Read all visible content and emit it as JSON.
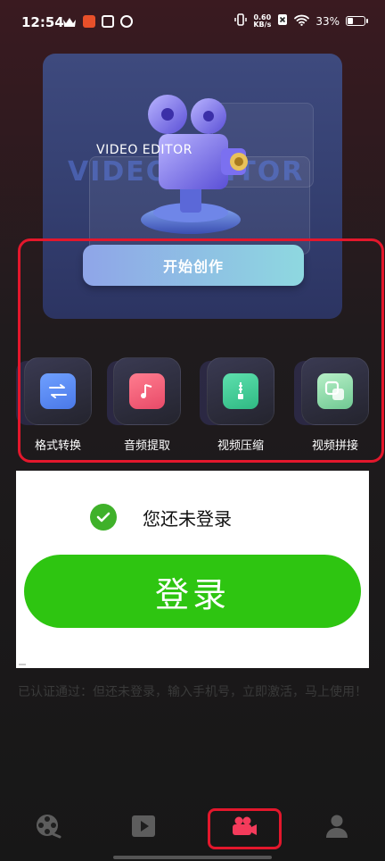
{
  "status_bar": {
    "time": "12:54",
    "net_speed_value": "0.60",
    "net_speed_unit": "KB/s",
    "battery": "33%",
    "battery_level": 0.33,
    "left_icons": [
      "crown-icon",
      "app-badge-icon",
      "store-icon",
      "link-icon"
    ],
    "right_icons": [
      "vibrate-icon",
      "net-speed-icon",
      "no-sim-icon",
      "wifi-icon",
      "battery-icon"
    ]
  },
  "hero": {
    "title": "VIDEO EDITOR",
    "watermark": "VIDEO EDITOR",
    "start_button": "开始创作"
  },
  "tools": [
    {
      "label": "格式转换",
      "icon": "swap-arrows-icon",
      "color": "#5b8bf0"
    },
    {
      "label": "音频提取",
      "icon": "music-note-icon",
      "color": "#f0627a"
    },
    {
      "label": "视频压缩",
      "icon": "zip-file-icon",
      "color": "#45d19b"
    },
    {
      "label": "视频拼接",
      "icon": "merge-squares-icon",
      "color": "#7fd3a0"
    }
  ],
  "login": {
    "status_text": "您还未登录",
    "button_label": "登录",
    "note": "已认证通过：但还未登录，输入手机号，立即激活，马上使用！"
  },
  "bottom_nav": [
    {
      "icon": "film-reel-icon",
      "active": false
    },
    {
      "icon": "play-square-icon",
      "active": false
    },
    {
      "icon": "video-camera-icon",
      "active": true
    },
    {
      "icon": "user-icon",
      "active": false
    }
  ],
  "colors": {
    "highlight_red": "#e3172c",
    "login_green": "#2ec511",
    "active_nav": "#f43b5b"
  }
}
